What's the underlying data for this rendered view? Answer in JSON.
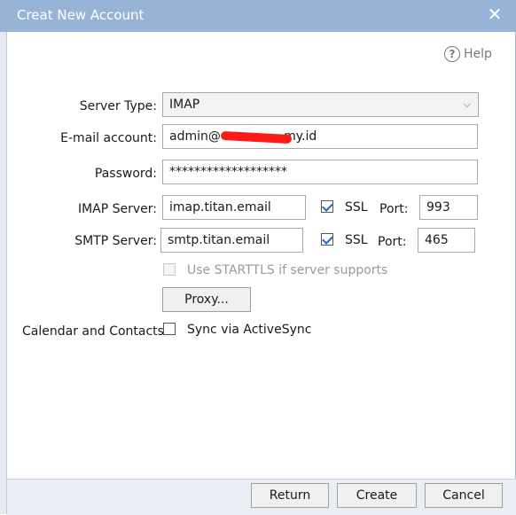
{
  "window": {
    "title": "Creat New Account"
  },
  "help": {
    "label": "Help"
  },
  "form": {
    "server_type": {
      "label": "Server Type:",
      "value": "IMAP"
    },
    "email": {
      "label": "E-mail account:",
      "value": "admin@                my.id"
    },
    "password": {
      "label": "Password:",
      "value": "*******************"
    },
    "imap": {
      "label": "IMAP Server:",
      "value": "imap.titan.email",
      "ssl_label": "SSL",
      "ssl_checked": true,
      "port_label": "Port:",
      "port": "993"
    },
    "smtp": {
      "label": "SMTP Server:",
      "value": "smtp.titan.email",
      "ssl_label": "SSL",
      "ssl_checked": true,
      "port_label": "Port:",
      "port": "465"
    },
    "starttls": {
      "label": "Use STARTTLS if server supports",
      "checked": false,
      "disabled": true
    },
    "proxy": {
      "label": "Proxy..."
    },
    "calendar": {
      "label": "Calendar and Contacts:",
      "sync_label": "Sync via ActiveSync",
      "checked": false
    }
  },
  "buttons": {
    "return": "Return",
    "create": "Create",
    "cancel": "Cancel"
  },
  "colors": {
    "titlebar": "#97b3d6",
    "redaction": "#ff1a1a",
    "check": "#1e66c4"
  }
}
